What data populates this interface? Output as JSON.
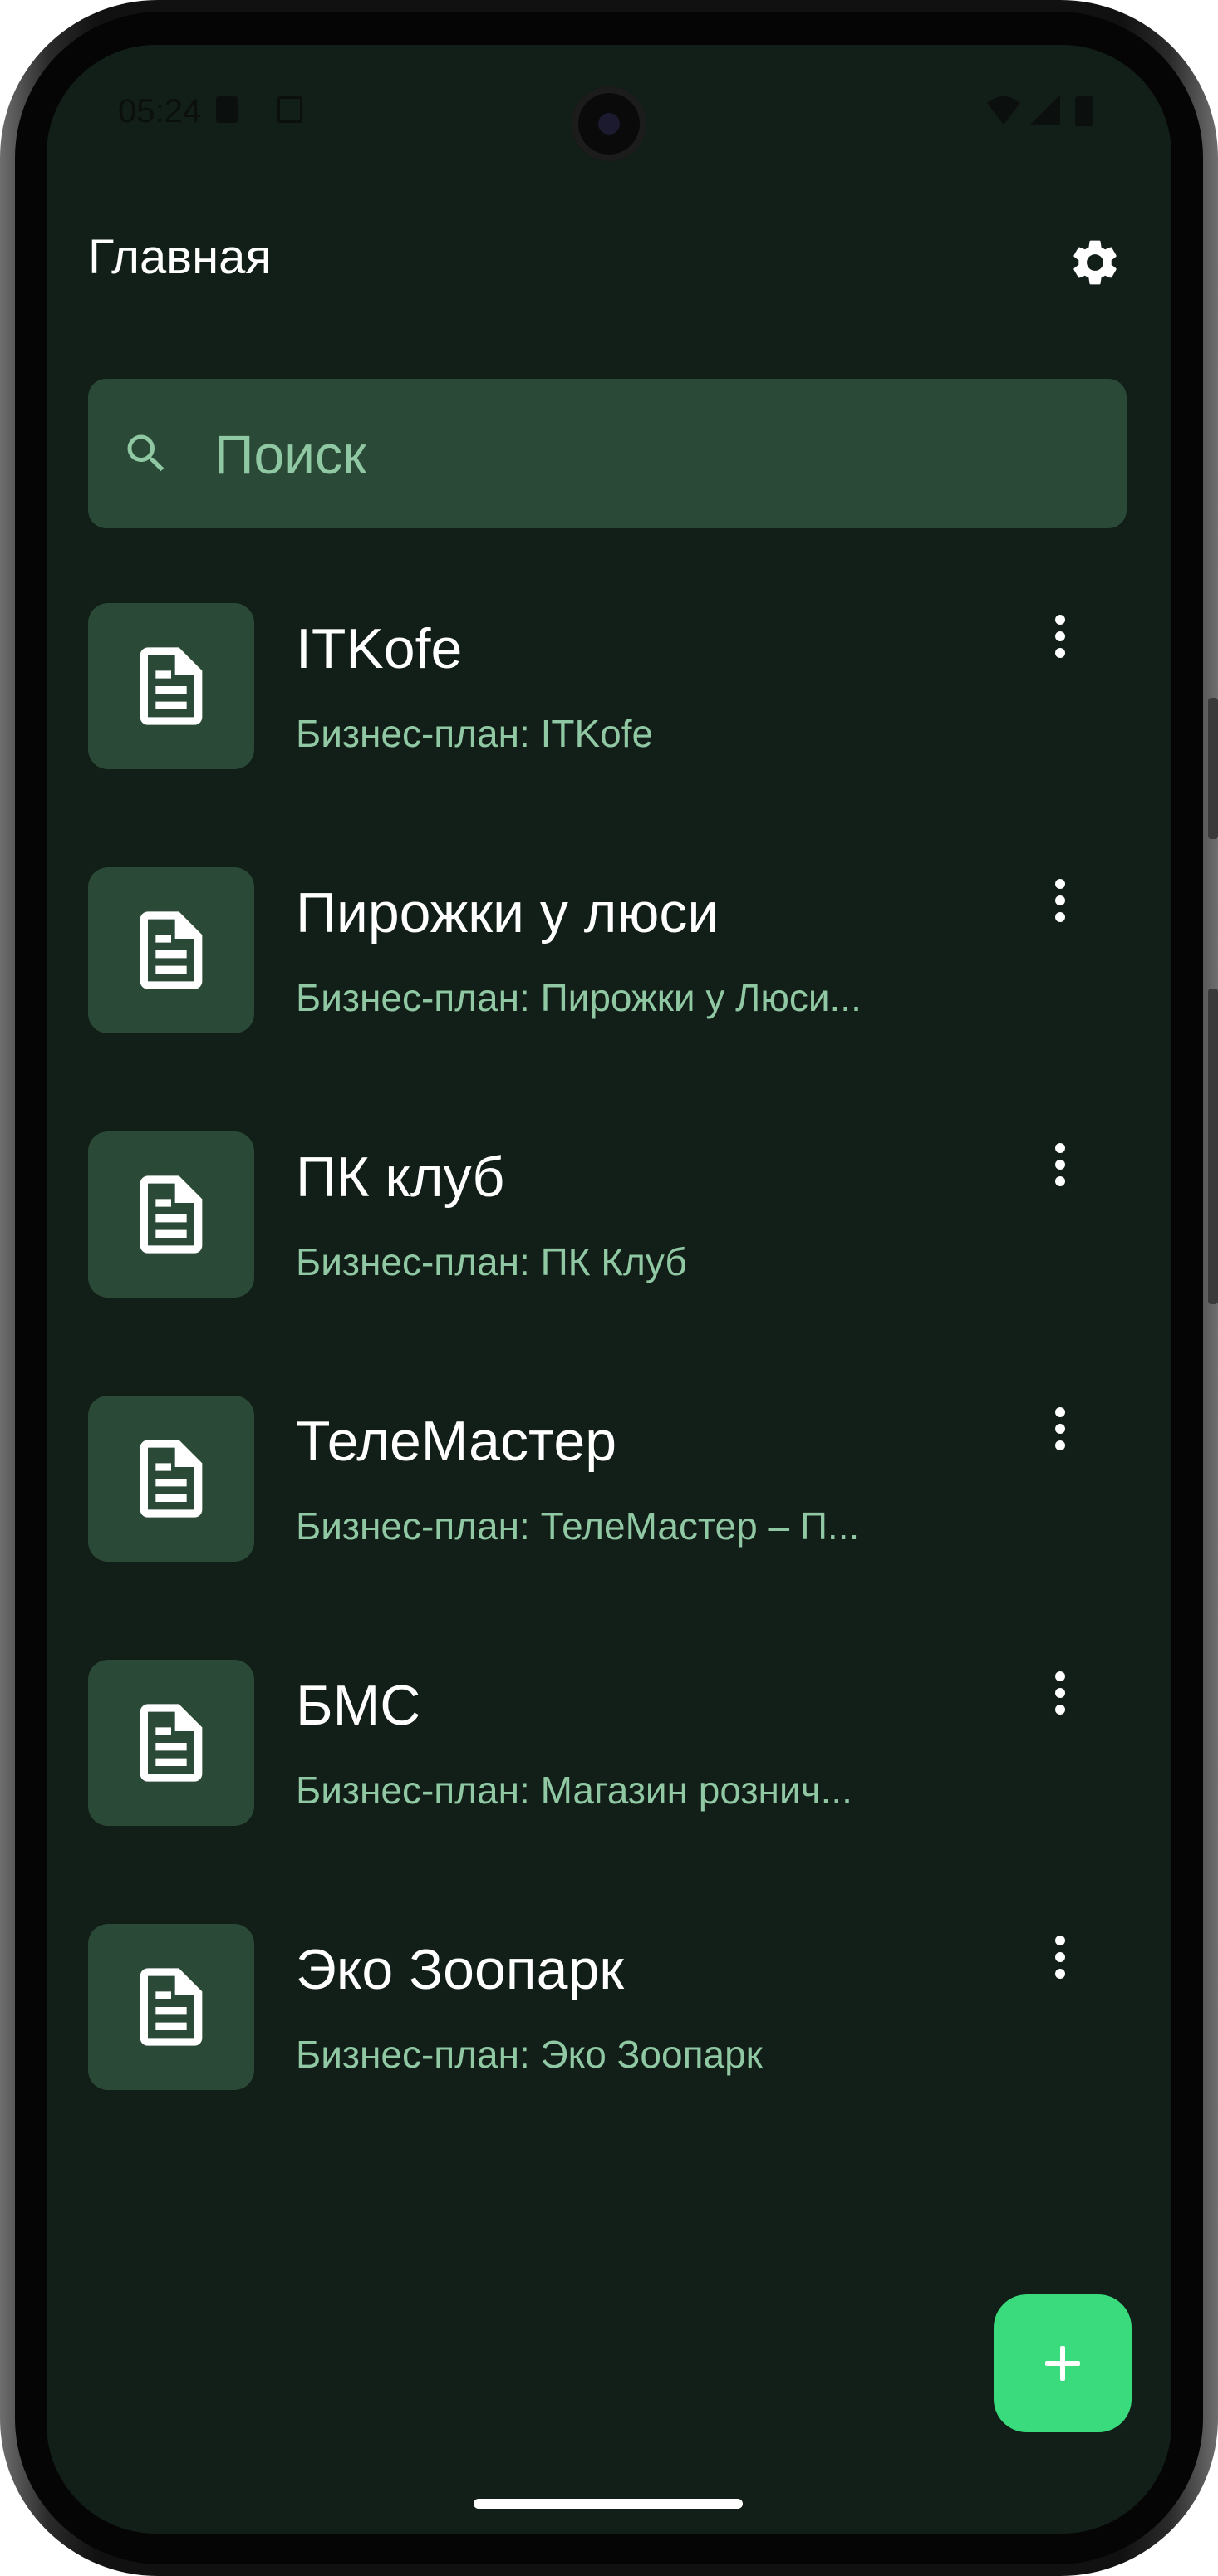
{
  "status_bar": {
    "time": "05:24"
  },
  "header": {
    "title": "Главная",
    "settings_icon": "gear-icon"
  },
  "search": {
    "placeholder": "Поиск",
    "value": "",
    "icon": "search-icon"
  },
  "plans": [
    {
      "title": "ITKofe",
      "subtitle": "Бизнес-план: ITKofe",
      "icon": "document-icon"
    },
    {
      "title": "Пирожки у люси",
      "subtitle": "Бизнес-план: Пирожки у Люси...",
      "icon": "document-icon"
    },
    {
      "title": "ПК клуб",
      "subtitle": "Бизнес-план: ПК Клуб",
      "icon": "document-icon"
    },
    {
      "title": "ТелеМастер",
      "subtitle": "Бизнес-план: ТелеМастер – П...",
      "icon": "document-icon"
    },
    {
      "title": "БМС",
      "subtitle": "Бизнес-план: Магазин рознич...",
      "icon": "document-icon"
    },
    {
      "title": "Эко Зоопарк",
      "subtitle": "Бизнес-план: Эко Зоопарк",
      "icon": "document-icon"
    }
  ],
  "fab": {
    "icon": "plus-icon"
  },
  "colors": {
    "background": "#121e18",
    "surface": "#2a4a37",
    "accent": "#39db7c",
    "subtitle": "#8fc8a2"
  }
}
